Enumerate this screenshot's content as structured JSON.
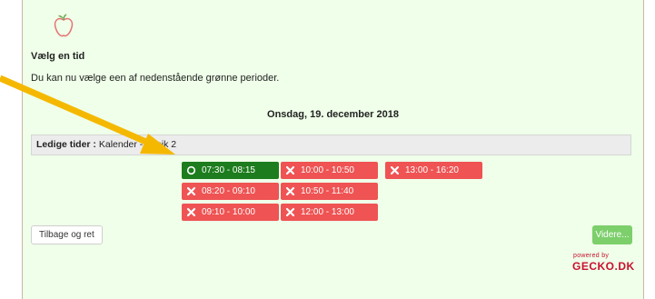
{
  "heading": "Vælg en tid",
  "description": "Du kan nu vælge een af nedenstående grønne perioder.",
  "date": "Onsdag, 19. december 2018",
  "filter": {
    "label": "Ledige tider :",
    "value": "Kalender - Klinik 2"
  },
  "slots": [
    {
      "time": "07:30 - 08:15",
      "status": "available"
    },
    {
      "time": "10:00 - 10:50",
      "status": "unavailable"
    },
    {
      "time": "13:00 - 16:20",
      "status": "unavailable"
    },
    {
      "time": "08:20 - 09:10",
      "status": "unavailable"
    },
    {
      "time": "10:50 - 11:40",
      "status": "unavailable"
    },
    {
      "time": "09:10 - 10:00",
      "status": "unavailable"
    },
    {
      "time": "12:00 - 13:00",
      "status": "unavailable"
    }
  ],
  "buttons": {
    "back": "Tilbage og ret",
    "next": "Videre..."
  },
  "footer": {
    "powered": "powered by",
    "brand": "GECKO.DK"
  },
  "colors": {
    "available": "#1d7c1d",
    "unavailable": "#ef5353",
    "next": "#7ccf6b",
    "panel": "#efffe9",
    "arrow": "#f5b800"
  },
  "icons": {
    "logo": "apple-icon",
    "available": "radio-icon",
    "unavailable": "x-icon"
  }
}
